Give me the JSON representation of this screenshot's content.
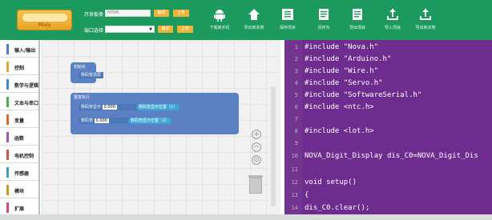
{
  "toolbar": {
    "logo_text": "Mixly",
    "board_label": "开发板类",
    "board_value": "NOVA",
    "port_label": "端口选择",
    "upload_buttons": [
      "编译",
      "上传"
    ],
    "tools": [
      {
        "icon": "android-icon",
        "label": "下载到手机"
      },
      {
        "icon": "home-icon",
        "label": "导出到本地"
      },
      {
        "icon": "save-icon",
        "label": "保存项目"
      },
      {
        "icon": "document-icon",
        "label": "另存为"
      },
      {
        "icon": "document-icon",
        "label": "导出项目"
      },
      {
        "icon": "upload-icon",
        "label": "导入项目"
      },
      {
        "icon": "upload-icon",
        "label": "导出到本地"
      }
    ]
  },
  "sidebar": {
    "items": [
      {
        "label": "输入/输出",
        "color": "#4e7ad0"
      },
      {
        "label": "控制",
        "color": "#e8a33a"
      },
      {
        "label": "数学与逻辑",
        "color": "#3f8ad0"
      },
      {
        "label": "文本与串口",
        "color": "#4fae4f"
      },
      {
        "label": "变量",
        "color": "#d86a2e"
      },
      {
        "label": "函数",
        "color": "#9b59b6"
      },
      {
        "label": "电机控制",
        "color": "#d0553a"
      },
      {
        "label": "传感器",
        "color": "#3a9fd0"
      },
      {
        "label": "模块",
        "color": "#c79a2a"
      },
      {
        "label": "扩展",
        "color": "#d04a7a"
      }
    ]
  },
  "workspace": {
    "block1": {
      "header": "初始化",
      "body": "数码管清屏"
    },
    "block2": {
      "header": "重复执行",
      "row1": {
        "label": "数码管显示",
        "value": "0.000",
        "tail": "数码管显示位置（1）"
      },
      "row2": {
        "label": "数码管",
        "value": "0.000",
        "tail": "数码管显示位置（2）"
      }
    },
    "zoom_controls": [
      "+",
      "−",
      "⊙"
    ]
  },
  "code": {
    "lines": [
      "#include \"Nova.h\"",
      "#include \"Arduino.h\"",
      "#include \"Wire.h\"",
      "#include \"Servo.h\"",
      "#include \"SoftwareSerial.h\"",
      "#include <ntc.h>",
      "",
      "#include <lot.h>",
      "",
      "NOVA_Digit_Display dis_C0=NOVA_Digit_Dis",
      "",
      "void setup()",
      "{",
      "    dis_C0.clear();"
    ]
  }
}
